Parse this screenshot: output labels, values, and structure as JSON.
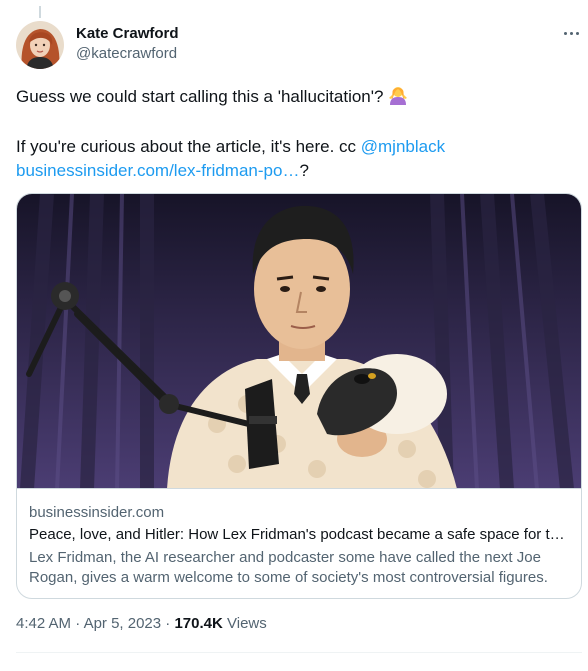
{
  "author": {
    "display_name": "Kate Crawford",
    "handle": "@katecrawford"
  },
  "tweet": {
    "line1": "Guess we could start calling this a 'hallucitation'? ",
    "emoji": "person-shrugging-emoji",
    "line2_prefix": "If you're curious about the article, it's here. cc ",
    "mention": "@mjnblack",
    "url": "businessinsider.com/lex-fridman-po…",
    "url_suffix": "?"
  },
  "card": {
    "domain": "businessinsider.com",
    "title": "Peace, love, and Hitler: How Lex Fridman's podcast became a safe space for t…",
    "description": "Lex Fridman, the AI researcher and podcaster some have called the next Joe Rogan, gives a warm welcome to some of society's most controversial figures."
  },
  "meta": {
    "time": "4:42 AM",
    "sep1": " · ",
    "date": "Apr 5, 2023",
    "sep2": " · ",
    "views_count": "170.4K",
    "views_label": " Views"
  },
  "colors": {
    "link": "#1d9bf0",
    "muted": "#536471",
    "text": "#0f1419",
    "border": "#cfd9de"
  }
}
